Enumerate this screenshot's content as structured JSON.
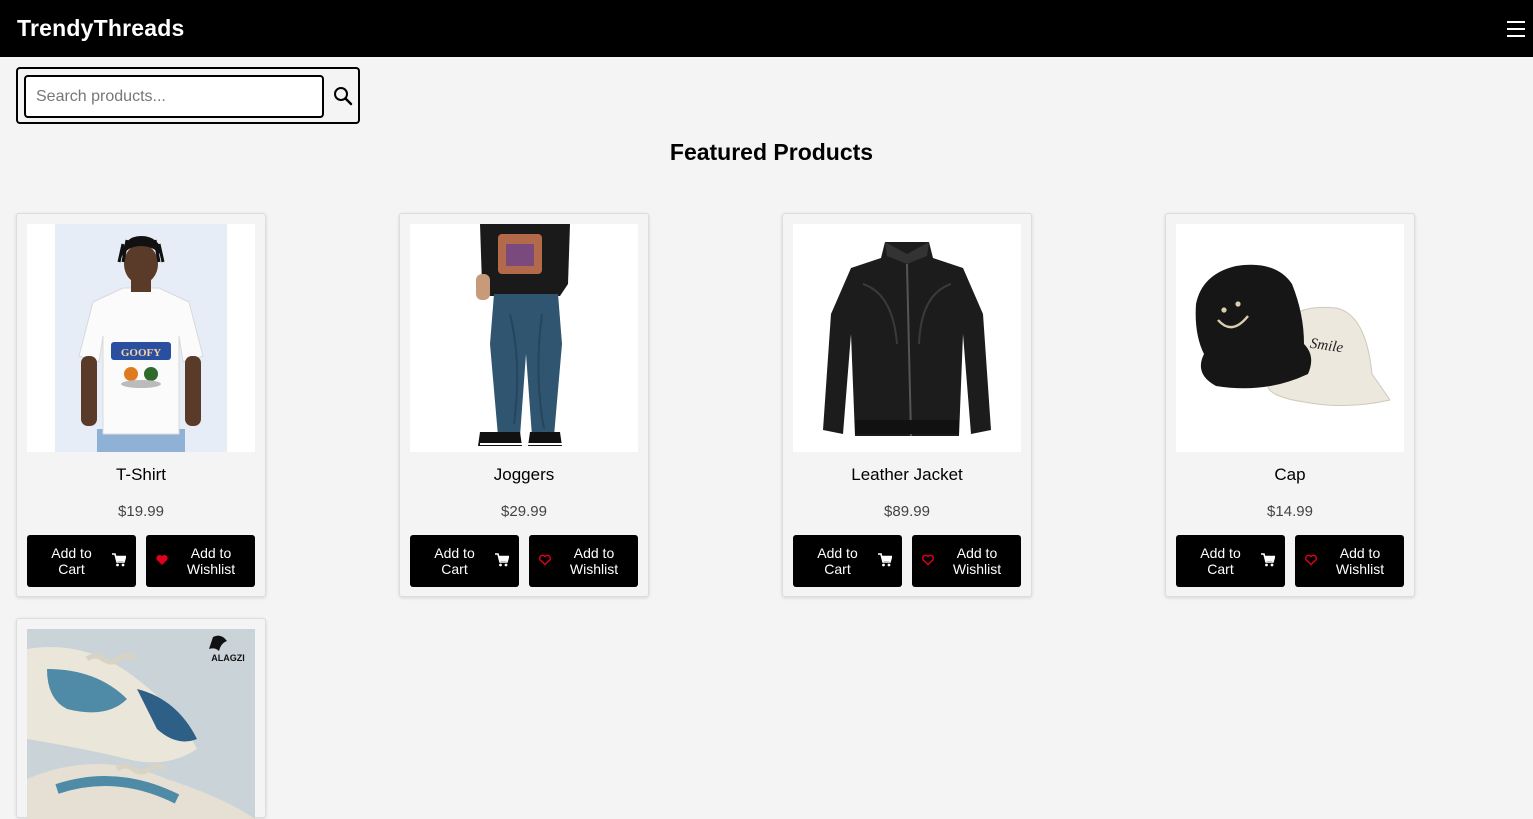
{
  "navbar": {
    "brand": "TrendyThreads",
    "menu_icon": "hamburger-menu-icon"
  },
  "search": {
    "placeholder": "Search products...",
    "value": "",
    "icon": "search-icon"
  },
  "section_title": "Featured Products",
  "colors": {
    "navbar_bg": "#000000",
    "page_bg": "#f4f4f4",
    "button_bg": "#000000",
    "heart_red": "#e0001b"
  },
  "products": [
    {
      "name": "T-Shirt",
      "price": "$19.99",
      "cart_label": "Add to Cart",
      "wishlist_label": "Add to Wishlist",
      "wishlist_filled": true
    },
    {
      "name": "Joggers",
      "price": "$29.99",
      "cart_label": "Add to Cart",
      "wishlist_label": "Add to Wishlist",
      "wishlist_filled": false
    },
    {
      "name": "Leather Jacket",
      "price": "$89.99",
      "cart_label": "Add to Cart",
      "wishlist_label": "Add to Wishlist",
      "wishlist_filled": false
    },
    {
      "name": "Cap",
      "price": "$14.99",
      "cart_label": "Add to Cart",
      "wishlist_label": "Add to Wishlist",
      "wishlist_filled": false
    }
  ],
  "partial_product": {
    "brand_logo_text": "ALAGZI"
  }
}
